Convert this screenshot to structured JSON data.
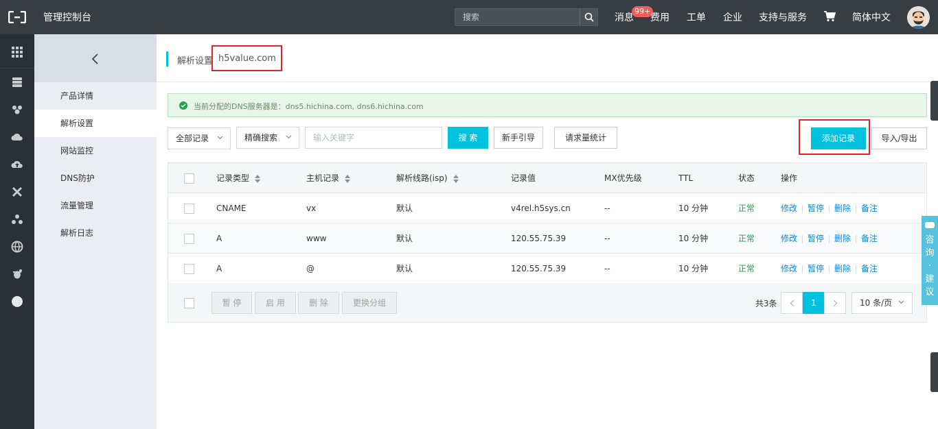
{
  "topbar": {
    "title": "管理控制台",
    "search_placeholder": "搜索",
    "nav": [
      "消息",
      "费用",
      "工单",
      "企业",
      "支持与服务",
      "简体中文"
    ],
    "message_badge": "99+"
  },
  "iconbar": {
    "icons": [
      "apps-grid-icon",
      "database-icon",
      "cdn-icon",
      "cloud-icon",
      "cloud-upload-icon",
      "tools-icon",
      "network-icon",
      "globe-icon",
      "bug-icon",
      "circle-icon"
    ]
  },
  "sidebar": {
    "back_icon": "chevron-left-icon",
    "items": [
      {
        "label": "产品详情"
      },
      {
        "label": "解析设置"
      },
      {
        "label": "网站监控"
      },
      {
        "label": "DNS防护"
      },
      {
        "label": "流量管理"
      },
      {
        "label": "解析日志"
      }
    ]
  },
  "page": {
    "title": "解析设置",
    "domain": "h5value.com"
  },
  "notice": {
    "text": "当前分配的DNS服务器是：dns5.hichina.com, dns6.hichina.com"
  },
  "toolbar": {
    "filter_select": "全部记录",
    "mode_select": "精确搜索",
    "keyword_placeholder": "输入关键字",
    "search_label": "搜 索",
    "guide_label": "新手引导",
    "stats_label": "请求量统计",
    "add_label": "添加记录",
    "import_export_label": "导入/导出"
  },
  "table": {
    "headers": {
      "type": "记录类型",
      "host": "主机记录",
      "line": "解析线路(isp)",
      "value": "记录值",
      "mx": "MX优先级",
      "ttl": "TTL",
      "status": "状态",
      "ops": "操作"
    },
    "rows": [
      {
        "type": "CNAME",
        "host": "vx",
        "line": "默认",
        "value": "v4rel.h5sys.cn",
        "mx": "--",
        "ttl": "10 分钟",
        "status": "正常"
      },
      {
        "type": "A",
        "host": "www",
        "line": "默认",
        "value": "120.55.75.39",
        "mx": "--",
        "ttl": "10 分钟",
        "status": "正常"
      },
      {
        "type": "A",
        "host": "@",
        "line": "默认",
        "value": "120.55.75.39",
        "mx": "--",
        "ttl": "10 分钟",
        "status": "正常"
      }
    ],
    "ops": {
      "edit": "修改",
      "pause": "暂停",
      "delete": "删除",
      "note": "备注"
    }
  },
  "footer": {
    "pause": "暂 停",
    "enable": "启 用",
    "delete": "删 除",
    "group": "更换分组",
    "total": "共3条",
    "current_page": "1",
    "page_size": "10 条/页"
  },
  "consult": {
    "chars": [
      "咨",
      "询",
      "·",
      "建",
      "议"
    ]
  },
  "colors": {
    "accent": "#00c1de",
    "topbar": "#373d41",
    "status_ok": "#1e9f4a",
    "link": "#0e87d7",
    "highlight": "#e0252a"
  }
}
